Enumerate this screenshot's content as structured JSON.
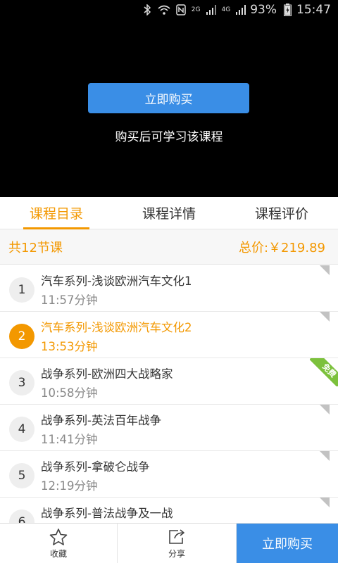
{
  "status_bar": {
    "network_type": "2G",
    "network_type_2": "4G",
    "battery_percent": "93%",
    "time": "15:47"
  },
  "video": {
    "buy_button_label": "立即购买",
    "hint": "购买后可学习该课程"
  },
  "tabs": [
    {
      "label": "课程目录",
      "active": true
    },
    {
      "label": "课程详情",
      "active": false
    },
    {
      "label": "课程评价",
      "active": false
    }
  ],
  "summary": {
    "lesson_count": "共12节课",
    "total_price": "总价:￥219.89"
  },
  "lessons": [
    {
      "num": "1",
      "title": "汽车系列-浅谈欧洲汽车文化1",
      "duration": "11:57分钟",
      "active": false,
      "free": false
    },
    {
      "num": "2",
      "title": "汽车系列-浅谈欧洲汽车文化2",
      "duration": "13:53分钟",
      "active": true,
      "free": false
    },
    {
      "num": "3",
      "title": "战争系列-欧洲四大战略家",
      "duration": "10:58分钟",
      "active": false,
      "free": true,
      "badge": "免费"
    },
    {
      "num": "4",
      "title": "战争系列-英法百年战争",
      "duration": "11:41分钟",
      "active": false,
      "free": false
    },
    {
      "num": "5",
      "title": "战争系列-拿破仑战争",
      "duration": "12:19分钟",
      "active": false,
      "free": false
    },
    {
      "num": "6",
      "title": "战争系列-普法战争及一战",
      "duration": "",
      "active": false,
      "free": false
    }
  ],
  "bottom_bar": {
    "favorite_label": "收藏",
    "favorite_icon": "star-icon",
    "share_label": "分享",
    "share_icon": "share-icon",
    "buy_label": "立即购买"
  },
  "colors": {
    "accent_orange": "#f39800",
    "accent_blue": "#3a8ee6",
    "free_green": "#7cc13c"
  }
}
